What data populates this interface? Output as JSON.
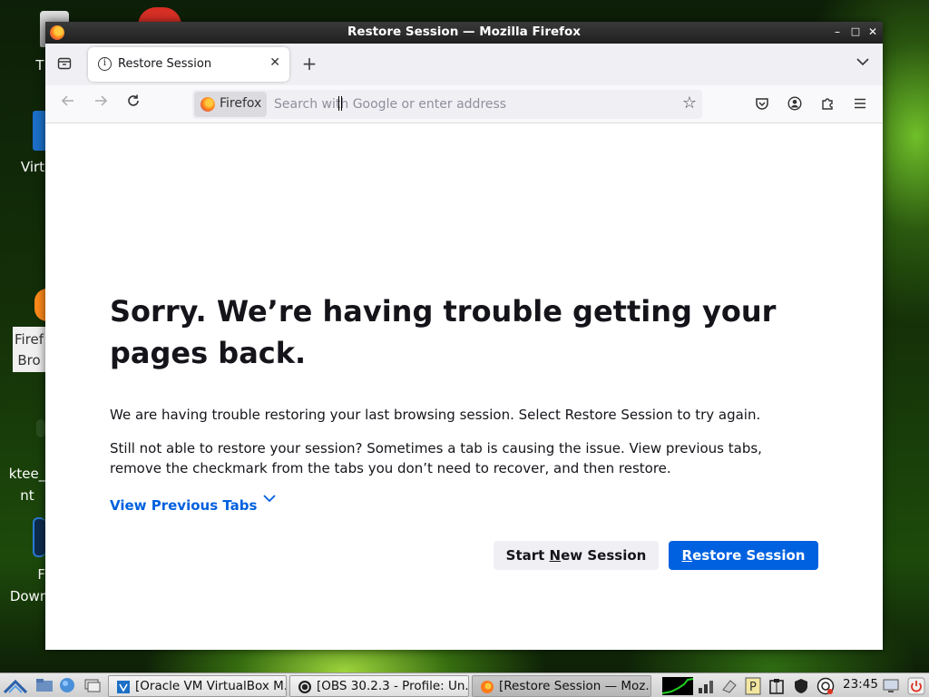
{
  "desktop": {
    "icons": [
      {
        "label": "T"
      },
      {
        "label": "Virt"
      },
      {
        "label": "Firef Bro"
      },
      {
        "label": "ktee_ nt"
      },
      {
        "label": "F Dowr"
      }
    ]
  },
  "window": {
    "title": "Restore Session — Mozilla Firefox",
    "controls": {
      "minimize": "–",
      "maximize": "□",
      "close": "✕"
    }
  },
  "tabs": [
    {
      "label": "Restore Session"
    }
  ],
  "tabstrip": {
    "new_tab": "+",
    "list_all": "⌄"
  },
  "urlbar": {
    "identity": "Firefox",
    "placeholder": "Search with Google or enter address"
  },
  "page": {
    "heading": "Sorry. We’re having trouble getting your pages back.",
    "paragraph1": "We are having trouble restoring your last browsing session. Select Restore Session to try again.",
    "paragraph2": "Still not able to restore your session? Sometimes a tab is causing the issue. View previous tabs, remove the checkmark from the tabs you don’t need to recover, and then restore.",
    "view_previous": "View Previous Tabs",
    "start_new_pre": "Start ",
    "start_new_key": "N",
    "start_new_post": "ew Session",
    "restore_key": "R",
    "restore_post": "estore Session"
  },
  "taskbar": {
    "tasks": [
      {
        "label": "[Oracle VM VirtualBox M..."
      },
      {
        "label": "[OBS 30.2.3 - Profile: Un..."
      },
      {
        "label": "[Restore Session — Moz..."
      }
    ],
    "clock": "23:45"
  },
  "colors": {
    "accent": "#0061e0",
    "link": "#0060df"
  }
}
